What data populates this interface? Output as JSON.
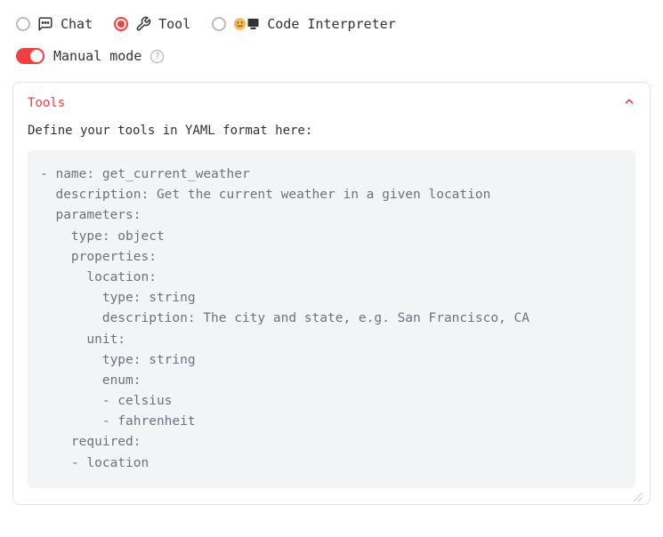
{
  "modes": {
    "chat": {
      "label": "Chat",
      "selected": false
    },
    "tool": {
      "label": "Tool",
      "selected": true
    },
    "code_interpreter": {
      "label": "Code Interpreter",
      "selected": false
    }
  },
  "manual_mode": {
    "label": "Manual mode",
    "enabled": true
  },
  "panel": {
    "title": "Tools",
    "description": "Define your tools in YAML format here:",
    "expanded": true,
    "yaml": "- name: get_current_weather\n  description: Get the current weather in a given location\n  parameters:\n    type: object\n    properties:\n      location:\n        type: string\n        description: The city and state, e.g. San Francisco, CA\n      unit:\n        type: string\n        enum:\n        - celsius\n        - fahrenheit\n    required:\n    - location"
  },
  "icons": {
    "chat": "chat-bubble-icon",
    "tool": "tools-icon",
    "code": "code-interpreter-icon",
    "help": "?",
    "chevron_up": "chevron-up-icon"
  }
}
